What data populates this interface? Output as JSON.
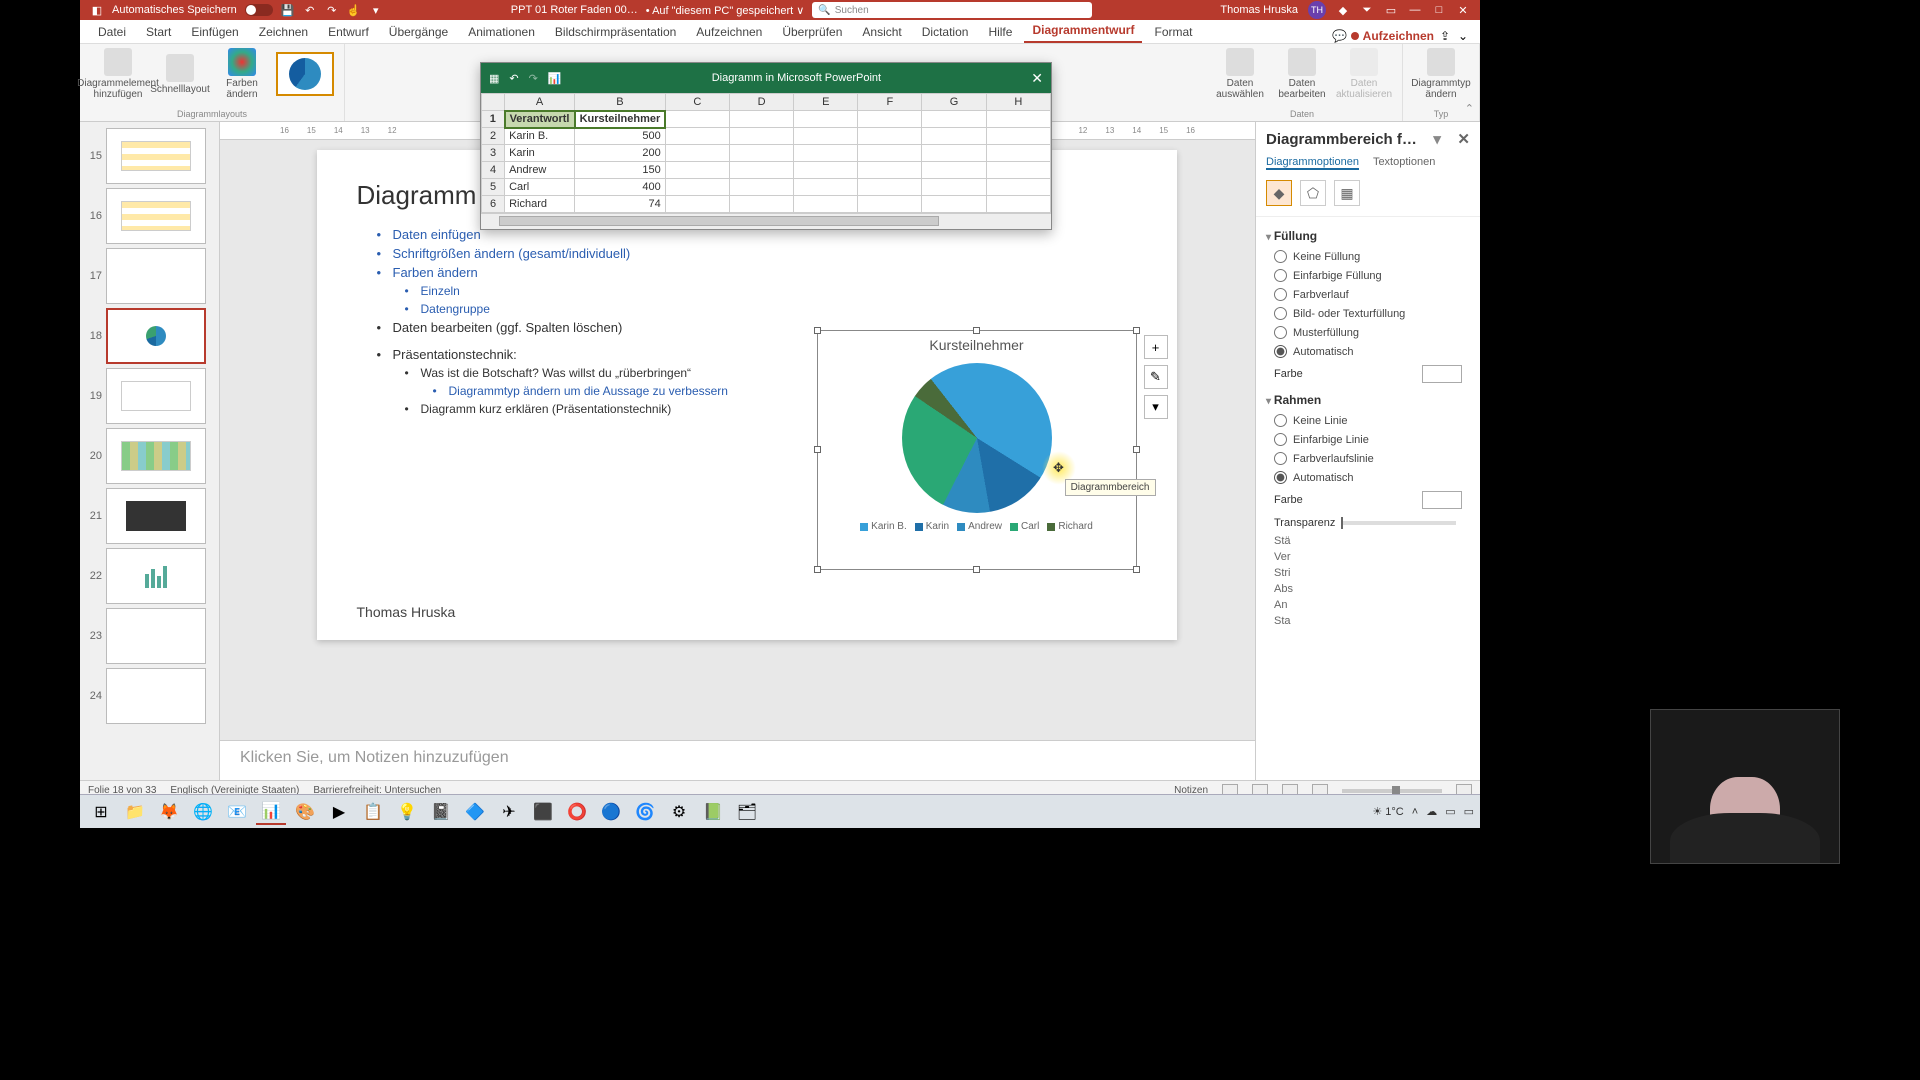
{
  "titlebar": {
    "autosave_label": "Automatisches Speichern",
    "doc_title": "PPT 01 Roter Faden 00…",
    "save_status": "• Auf \"diesem PC\" gespeichert ∨",
    "search_placeholder": "Suchen",
    "user_name": "Thomas Hruska",
    "user_initials": "TH"
  },
  "ribbon_tabs": [
    "Datei",
    "Start",
    "Einfügen",
    "Zeichnen",
    "Entwurf",
    "Übergänge",
    "Animationen",
    "Bildschirmpräsentation",
    "Aufzeichnen",
    "Überprüfen",
    "Ansicht",
    "Dictation",
    "Hilfe",
    "Diagrammentwurf",
    "Format"
  ],
  "ribbon_active_tab": "Diagrammentwurf",
  "ribbon_record": "Aufzeichnen",
  "ribbon_groups": {
    "layouts": {
      "add_element": "Diagrammelement hinzufügen",
      "quick_layout": "Schnelllayout",
      "change_colors": "Farben ändern",
      "label": "Diagrammlayouts"
    },
    "data": {
      "select": "Daten auswählen",
      "edit": "Daten bearbeiten",
      "refresh": "Daten aktualisieren",
      "label": "Daten"
    },
    "type": {
      "change": "Diagrammtyp ändern",
      "label": "Typ"
    }
  },
  "datasheet": {
    "title": "Diagramm in Microsoft PowerPoint",
    "columns": [
      "A",
      "B",
      "C",
      "D",
      "E",
      "F",
      "G",
      "H"
    ],
    "header_row": [
      "Verantwortl",
      "Kursteilnehmer"
    ],
    "rows": [
      {
        "n": 2,
        "a": "Karin B.",
        "b": 500
      },
      {
        "n": 3,
        "a": "Karin",
        "b": 200
      },
      {
        "n": 4,
        "a": "Andrew",
        "b": 150
      },
      {
        "n": 5,
        "a": "Carl",
        "b": 400
      },
      {
        "n": 6,
        "a": "Richard",
        "b": 74
      }
    ]
  },
  "thumbs": [
    {
      "n": 15
    },
    {
      "n": 16
    },
    {
      "n": 17
    },
    {
      "n": 18,
      "active": true
    },
    {
      "n": 19
    },
    {
      "n": 20
    },
    {
      "n": 21
    },
    {
      "n": 22
    },
    {
      "n": 23
    },
    {
      "n": 24
    }
  ],
  "ruler_marks": [
    "16",
    "15",
    "14",
    "13",
    "12",
    "",
    "",
    "",
    "",
    "",
    "",
    "",
    "",
    "",
    "",
    "",
    "",
    "",
    "12",
    "13",
    "14",
    "15",
    "16"
  ],
  "slide": {
    "title": "Diagramm e",
    "bullets": {
      "b1": "Daten einfügen",
      "b2": "Schriftgrößen ändern (gesamt/individuell)",
      "b3": "Farben ändern",
      "b3a": "Einzeln",
      "b3b": "Datengruppe",
      "b4": "Daten bearbeiten (ggf. Spalten löschen)",
      "b5": "Präsentationstechnik:",
      "b5a": "Was ist die Botschaft? Was willst du „rüberbringen“",
      "b5a1": "Diagrammtyp ändern um die Aussage zu verbessern",
      "b5b": "Diagramm kurz erklären (Präsentationstechnik)"
    },
    "author": "Thomas Hruska"
  },
  "chart_data": {
    "type": "pie",
    "title": "Kursteilnehmer",
    "categories": [
      "Karin B.",
      "Karin",
      "Andrew",
      "Carl",
      "Richard"
    ],
    "values": [
      500,
      200,
      150,
      400,
      74
    ],
    "colors": [
      "#37a0d9",
      "#1f6fa8",
      "#2e8bc0",
      "#2aa875",
      "#4a6b3a"
    ]
  },
  "chart_tooltip": "Diagrammbereich",
  "chart_side": {
    "add": "+",
    "style": "✎",
    "filter": "▾"
  },
  "notes_placeholder": "Klicken Sie, um Notizen hinzuzufügen",
  "fmtpane": {
    "title": "Diagrammbereich f…",
    "tab1": "Diagrammoptionen",
    "tab2": "Textoptionen",
    "fill_title": "Füllung",
    "fill_opts": [
      "Keine Füllung",
      "Einfarbige Füllung",
      "Farbverlauf",
      "Bild- oder Texturfüllung",
      "Musterfüllung",
      "Automatisch"
    ],
    "fill_selected": 5,
    "color_label": "Farbe",
    "border_title": "Rahmen",
    "border_opts": [
      "Keine Linie",
      "Einfarbige Linie",
      "Farbverlaufslinie",
      "Automatisch"
    ],
    "border_selected": 3,
    "transparency": "Transparenz",
    "partials": [
      "Stä",
      "Ver",
      "Stri",
      "Abs",
      "An",
      "Sta"
    ]
  },
  "statusbar": {
    "slide_info": "Folie 18 von 33",
    "lang": "Englisch (Vereinigte Staaten)",
    "access": "Barrierefreiheit: Untersuchen",
    "notes": "Notizen"
  },
  "taskbar": {
    "weather": "1°C"
  }
}
